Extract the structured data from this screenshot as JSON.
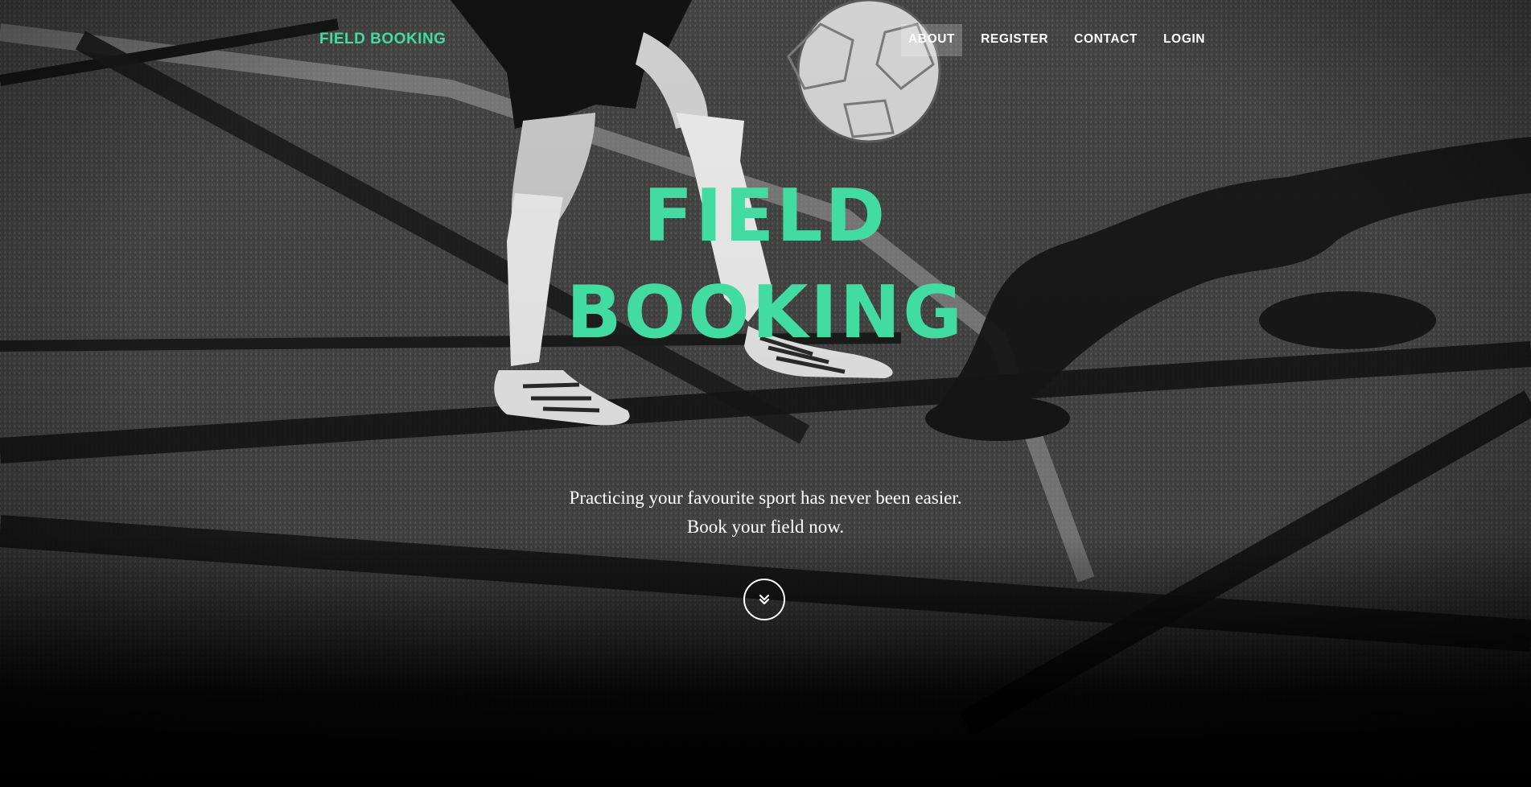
{
  "navbar": {
    "brand": "FIELD BOOKING",
    "links": [
      {
        "label": "ABOUT",
        "active": true
      },
      {
        "label": "REGISTER",
        "active": false
      },
      {
        "label": "CONTACT",
        "active": false
      },
      {
        "label": "LOGIN",
        "active": false
      }
    ]
  },
  "hero": {
    "title_line1": "FIELD",
    "title_line2": "BOOKING",
    "tagline_line1": "Practicing your favourite sport has never been easier.",
    "tagline_line2": "Book your field now.",
    "scroll_icon": "chevron-double-down-icon"
  },
  "colors": {
    "accent": "#42dca3",
    "nav_text": "#ffffff",
    "active_nav_bg": "rgba(255,255,255,0.22)",
    "background": "#000000"
  }
}
